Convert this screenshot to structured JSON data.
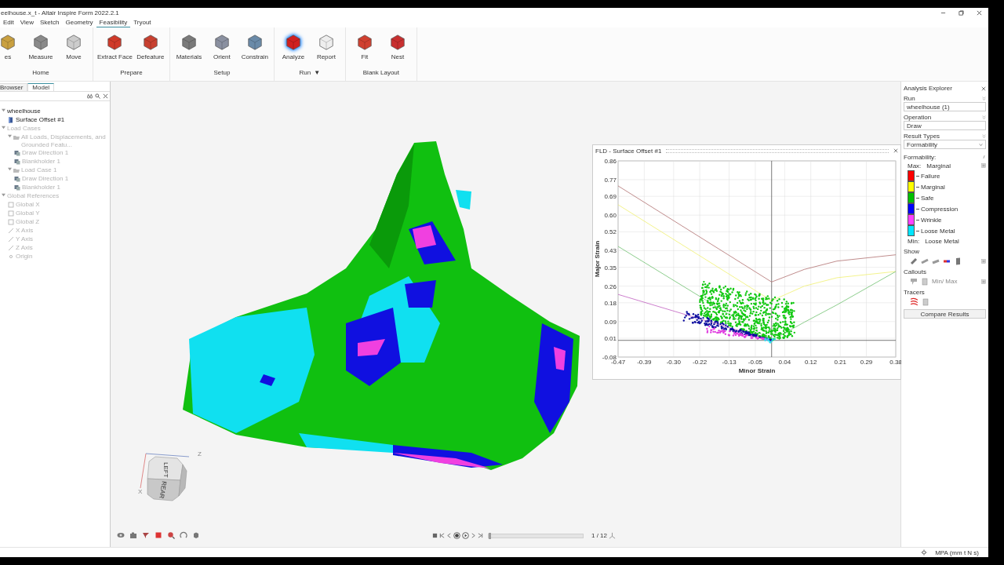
{
  "window": {
    "title": "eelhouse.x_t - Altair Inspire Form 2022.2.1"
  },
  "menu": [
    {
      "label": "Edit",
      "selected": false
    },
    {
      "label": "View",
      "selected": false
    },
    {
      "label": "Sketch",
      "selected": false
    },
    {
      "label": "Geometry",
      "selected": false
    },
    {
      "label": "Feasibility",
      "selected": true
    },
    {
      "label": "Tryout",
      "selected": false
    }
  ],
  "ribbon": [
    {
      "label": "Home",
      "tools": [
        {
          "label": "es",
          "selected": false
        },
        {
          "label": "Measure",
          "selected": false
        },
        {
          "label": "Move",
          "selected": false
        }
      ]
    },
    {
      "label": "Prepare",
      "tools": [
        {
          "label": "Extract Face",
          "selected": false
        },
        {
          "label": "Defeature",
          "selected": false
        }
      ]
    },
    {
      "label": "Setup",
      "tools": [
        {
          "label": "Materials",
          "selected": false
        },
        {
          "label": "Orient",
          "selected": false
        },
        {
          "label": "Constrain",
          "selected": false
        }
      ]
    },
    {
      "label": "Run",
      "caret": "▼",
      "tools": [
        {
          "label": "Analyze",
          "selected": true
        },
        {
          "label": "Report",
          "selected": false
        }
      ]
    },
    {
      "label": "Blank Layout",
      "tools": [
        {
          "label": "Fit",
          "selected": false
        },
        {
          "label": "Nest",
          "selected": false
        }
      ]
    }
  ],
  "browser": {
    "tabs": [
      {
        "label": "Browser",
        "selected": false
      },
      {
        "label": "Model",
        "selected": true
      }
    ],
    "tree": [
      {
        "label": "wheelhouse",
        "muted": false,
        "expanded": true,
        "children": [
          {
            "label": "Surface Offset #1",
            "kind": "part",
            "muted": false
          }
        ]
      },
      {
        "label": "Load Cases",
        "muted": true,
        "expanded": true,
        "children": [
          {
            "label": "All Loads, Displacements, and Grounded Featu...",
            "kind": "folder",
            "muted": true,
            "expanded": true,
            "children": [
              {
                "label": "Draw Direction 1",
                "kind": "load",
                "muted": true
              },
              {
                "label": "Blankholder 1",
                "kind": "load",
                "muted": true
              }
            ]
          },
          {
            "label": "Load Case 1",
            "kind": "folder",
            "muted": true,
            "expanded": true,
            "children": [
              {
                "label": "Draw Direction 1",
                "kind": "load",
                "muted": true
              },
              {
                "label": "Blankholder 1",
                "kind": "load",
                "muted": true
              }
            ]
          }
        ]
      },
      {
        "label": "Global References",
        "muted": true,
        "expanded": true,
        "children": [
          {
            "label": "Global X",
            "kind": "plane",
            "muted": true
          },
          {
            "label": "Global Y",
            "kind": "plane",
            "muted": true
          },
          {
            "label": "Global Z",
            "kind": "plane",
            "muted": true
          },
          {
            "label": "X Axis",
            "kind": "axis",
            "muted": true
          },
          {
            "label": "Y Axis",
            "kind": "axis",
            "muted": true
          },
          {
            "label": "Z Axis",
            "kind": "axis",
            "muted": true
          },
          {
            "label": "Origin",
            "kind": "point",
            "muted": true
          }
        ]
      }
    ]
  },
  "viewport": {
    "view_cube": {
      "faces": [
        "LEFT",
        "REAR"
      ],
      "axes": [
        "Z",
        "X"
      ]
    },
    "frame": "1 / 12",
    "timeline": {
      "level": 0
    },
    "fld_window": {
      "title": "FLD - Surface Offset #1",
      "chart_data": {
        "type": "line",
        "grid": true,
        "xlabel": "Minor Strain",
        "ylabel": "Major Strain",
        "x": [
          -0.47,
          0,
          0.1,
          0.2,
          0.38
        ],
        "xlim": [
          -0.47,
          0.38
        ],
        "ylim": [
          -0.08,
          0.86
        ],
        "xticks": [
          -0.47,
          -0.39,
          {
            "value": -0.3,
            "label": "-0.30"
          },
          -0.22,
          -0.13,
          -0.05,
          0.04,
          0.12,
          0.21,
          0.29,
          0.38
        ],
        "yticks": [
          -0.08,
          0.01,
          0.09,
          0.18,
          0.26,
          0.35,
          0.43,
          0.52,
          {
            "value": 0.6,
            "label": "0.60"
          },
          0.69,
          0.77,
          0.86
        ],
        "series": [
          {
            "color": "#b07070",
            "values": [
              0.74,
              0.28,
              0.34,
              0.38,
              0.41
            ]
          },
          {
            "color": "#f0f070",
            "values": [
              0.65,
              0.19,
              0.26,
              0.3,
              0.33
            ]
          },
          {
            "color": "#70c070",
            "values": [
              0.45,
              0,
              0.087,
              0.17,
              0.33
            ]
          },
          {
            "color": "#c060c0",
            "values": [
              0.22,
              0,
              null,
              null,
              null
            ]
          }
        ]
      }
    }
  },
  "analysis_explorer": {
    "title": "Analysis Explorer",
    "run": {
      "label": "Run",
      "value": "wheelhouse (1)"
    },
    "operation": {
      "label": "Operation",
      "value": "Draw"
    },
    "result_types": {
      "label": "Result Types",
      "value": "Formability"
    },
    "legend": {
      "title": "Formability:",
      "max_label": "Max:",
      "max_value": "Marginal",
      "min_label": "Min:",
      "min_value": "Loose Metal",
      "items": [
        {
          "label": "Failure",
          "color": "#ff0000"
        },
        {
          "label": "Marginal",
          "color": "#ffff00"
        },
        {
          "label": "Safe",
          "color": "#00c000"
        },
        {
          "label": "Compression",
          "color": "#0000ff"
        },
        {
          "label": "Wrinkle",
          "color": "#ff40ff"
        },
        {
          "label": "Loose Metal",
          "color": "#00e5ff"
        }
      ]
    },
    "show_label": "Show",
    "callouts_label": "Callouts",
    "callouts_minmax": "Min/ Max",
    "tracers_label": "Tracers",
    "compare_button": "Compare Results"
  },
  "status_bar": {
    "units": "MPA (mm t N s)"
  }
}
